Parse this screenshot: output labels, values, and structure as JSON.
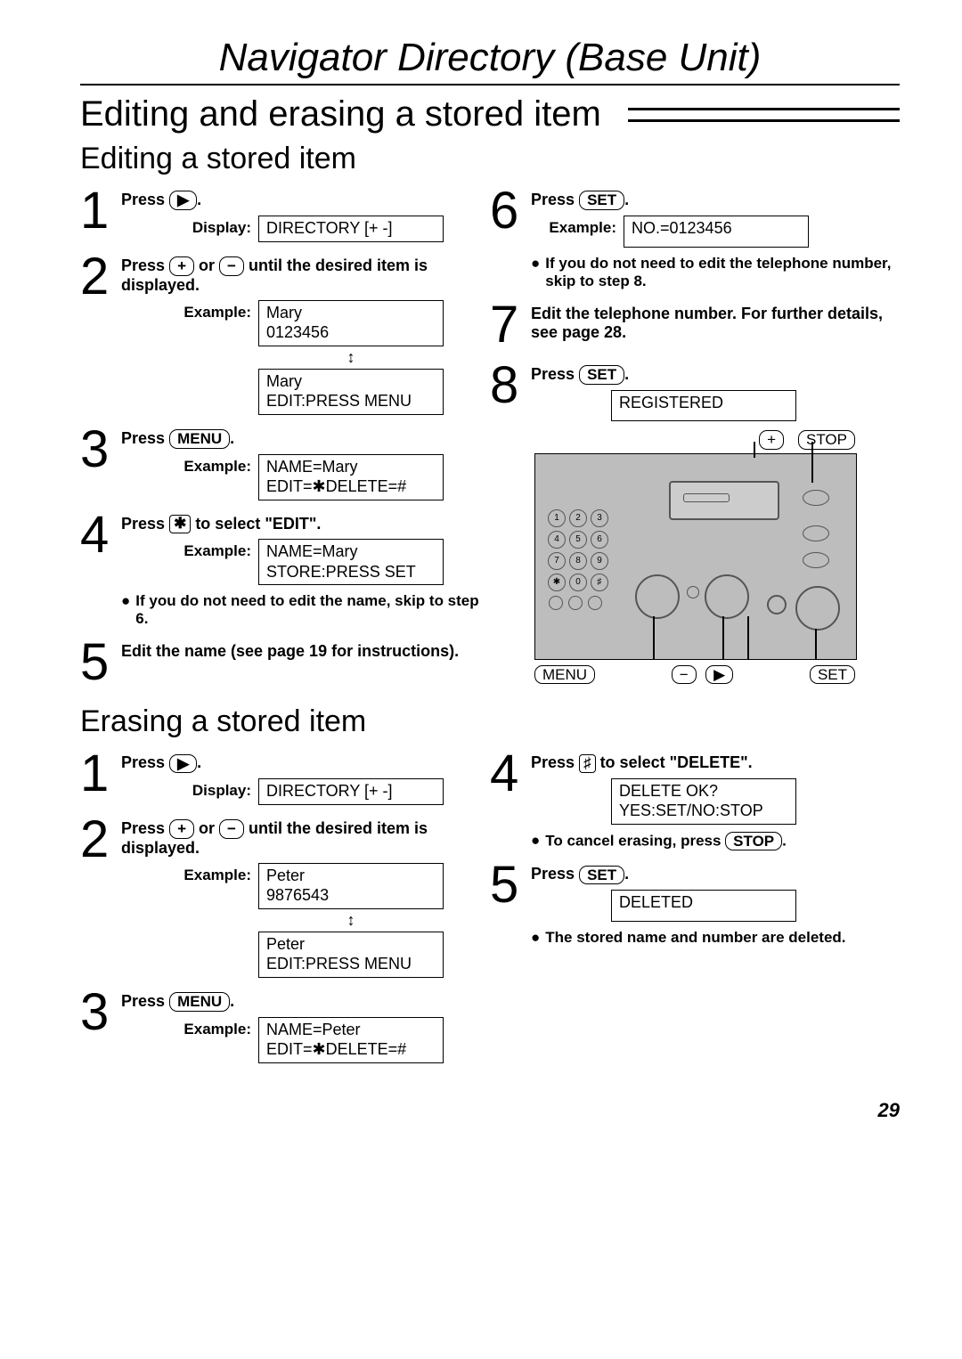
{
  "page_title": "Navigator Directory (Base Unit)",
  "h1": "Editing and erasing a stored item",
  "h2_edit": "Editing a stored item",
  "h2_erase": "Erasing a stored item",
  "labels": {
    "display": "Display:",
    "example": "Example:",
    "press": "Press"
  },
  "keys": {
    "play": "▶",
    "plus": "+",
    "minus": "−",
    "star": "✱",
    "hash": "♯",
    "menu": "MENU",
    "set": "SET",
    "stop": "STOP"
  },
  "edit": {
    "s1": {
      "display": "DIRECTORY  [+ -]"
    },
    "s2": {
      "text_a": "or",
      "text_b": "until the desired item is displayed.",
      "box1_l1": "Mary",
      "box1_l2": "0123456",
      "box2_l1": "Mary",
      "box2_l2": "EDIT:PRESS MENU"
    },
    "s3": {
      "box_l1": "NAME=Mary",
      "box_l2": "EDIT=✱DELETE=#"
    },
    "s4": {
      "text": " to select \"EDIT\".",
      "box_l1": "NAME=Mary",
      "box_l2": "STORE:PRESS SET",
      "note": "If you do not need to edit the name, skip to step 6."
    },
    "s5": {
      "text": "Edit the name (see page 19 for instructions)."
    },
    "s6": {
      "box": "NO.=0123456",
      "note": "If you do not need to edit the telephone number, skip to step 8."
    },
    "s7": {
      "text": "Edit the telephone number. For further details, see page 28."
    },
    "s8": {
      "box": "REGISTERED"
    }
  },
  "erase": {
    "s1": {
      "display": "DIRECTORY  [+ -]"
    },
    "s2": {
      "text_a": "or",
      "text_b": "until the desired item is displayed.",
      "box1_l1": "Peter",
      "box1_l2": "9876543",
      "box2_l1": "Peter",
      "box2_l2": "EDIT:PRESS MENU"
    },
    "s3": {
      "box_l1": "NAME=Peter",
      "box_l2": "EDIT=✱DELETE=#"
    },
    "s4": {
      "text": " to select \"DELETE\".",
      "box_l1": "DELETE OK?",
      "box_l2": "YES:SET/NO:STOP",
      "note": "To cancel erasing, press "
    },
    "s5": {
      "box": "DELETED",
      "note": "The stored name and number are deleted."
    }
  },
  "keypad": [
    "1",
    "2",
    "3",
    "4",
    "5",
    "6",
    "7",
    "8",
    "9",
    "✱",
    "0",
    "♯"
  ],
  "page_number": "29"
}
